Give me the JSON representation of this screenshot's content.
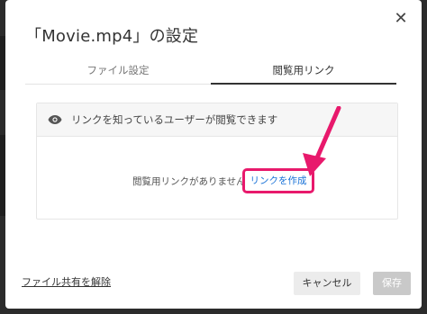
{
  "dialog": {
    "title": "「Movie.mp4」の設定",
    "close_icon": "close-icon"
  },
  "tabs": [
    {
      "label": "ファイル設定",
      "active": false
    },
    {
      "label": "閲覧用リンク",
      "active": true
    }
  ],
  "panel": {
    "header_icon": "eye-icon",
    "header_text": "リンクを知っているユーザーが閲覧できます",
    "no_link_text": "閲覧用リンクがありません",
    "create_link_label": "リンクを作成"
  },
  "footer": {
    "unshare_label": "ファイル共有を解除",
    "cancel_label": "キャンセル",
    "save_label": "保存"
  },
  "colors": {
    "highlight": "#e8196c",
    "link": "#1a73d8",
    "save_disabled": "#c9c9c9"
  }
}
